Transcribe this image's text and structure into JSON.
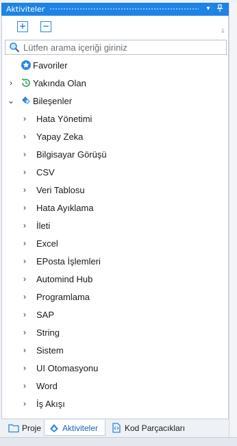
{
  "panel": {
    "title": "Aktiviteler",
    "dropdown_glyph": "▾",
    "pin_glyph": "ᛘ"
  },
  "toolbar": {
    "expand_all_glyph": "+",
    "collapse_all_glyph": "−",
    "scroll_glyph": "⇓"
  },
  "search": {
    "placeholder": "Lütfen arama içeriği giriniz",
    "value": ""
  },
  "tree": {
    "top": [
      {
        "label": "Favoriler",
        "icon": "star-badge-icon",
        "expandable": false
      },
      {
        "label": "Yakında Olan",
        "icon": "clock-history-icon",
        "expandable": true
      },
      {
        "label": "Bileşenler",
        "icon": "components-icon",
        "expandable": true,
        "expanded": true
      }
    ],
    "children": [
      "Hata Yönetimi",
      "Yapay Zeka",
      "Bilgisayar Görüşü",
      "CSV",
      "Veri Tablosu",
      "Hata Ayıklama",
      "İleti",
      "Excel",
      "EPosta İşlemleri",
      "Automind Hub",
      "Programlama",
      "SAP",
      "String",
      "Sistem",
      "UI Otomasyonu",
      "Word",
      "İş Akışı"
    ],
    "chevron_right": "›",
    "chevron_down": "⌄"
  },
  "tabs": [
    {
      "label": "Proje",
      "icon": "folder-icon",
      "active": false
    },
    {
      "label": "Aktiviteler",
      "icon": "activities-icon",
      "active": true
    },
    {
      "label": "Kod Parçacıkları",
      "icon": "snippet-icon",
      "active": false
    }
  ],
  "colors": {
    "accent": "#1f83e5",
    "icon_blue": "#2b87e0",
    "clock_green": "#2e9b5f"
  }
}
